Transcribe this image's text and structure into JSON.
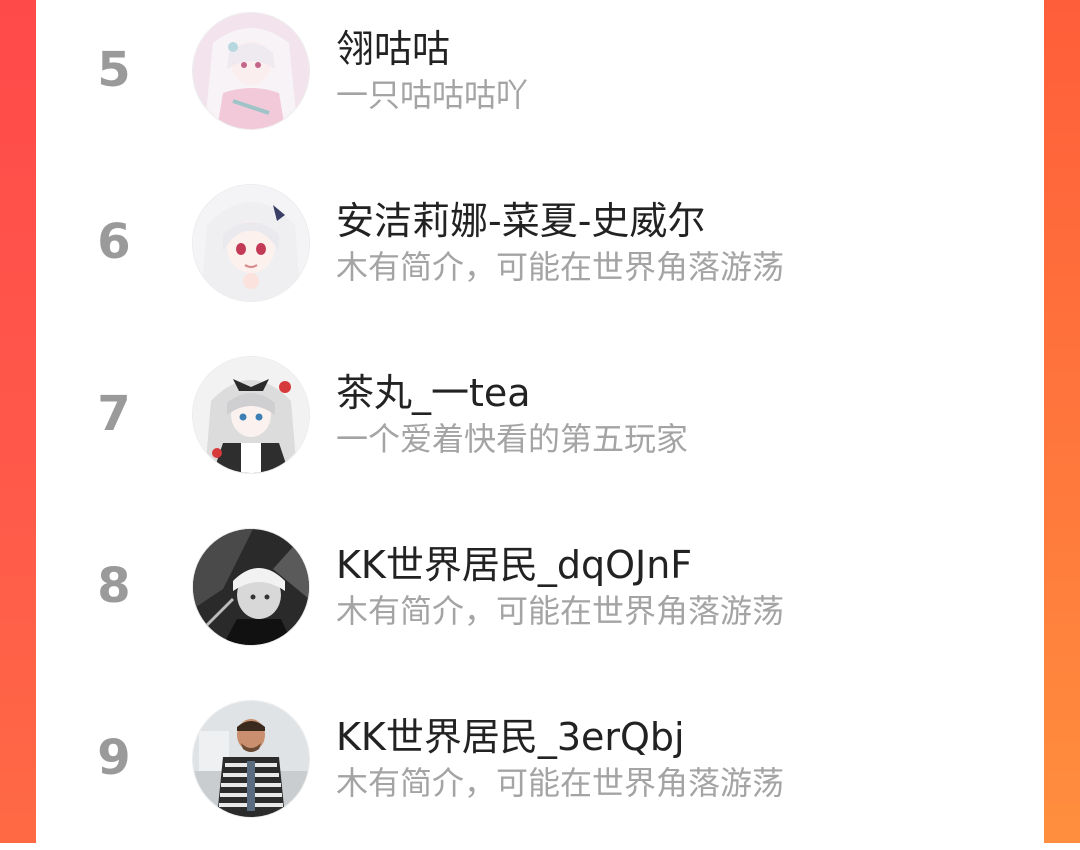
{
  "colors": {
    "rank_text": "#9a9a9a",
    "name_text": "#222222",
    "bio_text": "#a4a4a4",
    "side_gradient_left": "#ff4a4a",
    "side_gradient_right": "#ff8f3e"
  },
  "ranking": {
    "items": [
      {
        "rank": "5",
        "name": "翎咕咕",
        "bio": "一只咕咕咕吖",
        "avatar_icon": "anime-girl-avatar-icon"
      },
      {
        "rank": "6",
        "name": "安洁莉娜-菜夏-史威尔",
        "bio": "木有简介，可能在世界角落游荡",
        "avatar_icon": "anime-girl-avatar-icon"
      },
      {
        "rank": "7",
        "name": "茶丸_一tea",
        "bio": "一个爱着快看的第五玩家",
        "avatar_icon": "anime-maid-avatar-icon"
      },
      {
        "rank": "8",
        "name": "KK世界居民_dqOJnF",
        "bio": "木有简介，可能在世界角落游荡",
        "avatar_icon": "monochrome-anime-avatar-icon"
      },
      {
        "rank": "9",
        "name": "KK世界居民_3erQbj",
        "bio": "木有简介，可能在世界角落游荡",
        "avatar_icon": "man-photo-avatar-icon"
      }
    ]
  }
}
